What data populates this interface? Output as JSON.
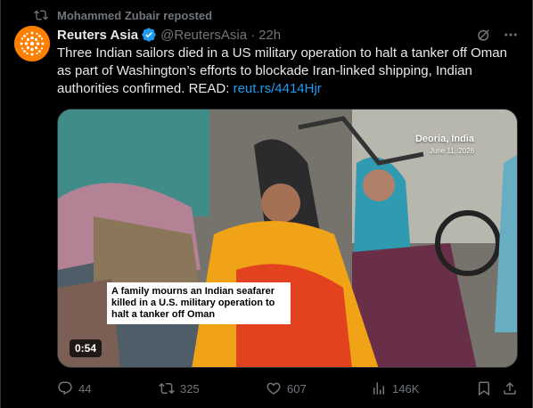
{
  "repost": {
    "icon": "repost-icon",
    "text": "Mohammed Zubair reposted"
  },
  "post": {
    "author_name": "Reuters Asia",
    "handle": "@ReutersAsia",
    "separator": "·",
    "time": "22h",
    "text": "Three Indian sailors died in a US military operation to halt a tanker off Oman as part of Washington’s efforts to blockade Iran-linked shipping, Indian authorities confirmed. READ: ",
    "link_text": "reut.rs/4414Hjr"
  },
  "media": {
    "location": "Deoria, India",
    "date": "June 11, 2026",
    "caption": "A family mourns an Indian seafarer killed in a U.S. military operation to halt a tanker off Oman",
    "duration": "0:54"
  },
  "actions": {
    "replies": "44",
    "reposts": "325",
    "likes": "607",
    "views": "146K"
  },
  "colors": {
    "link": "#1d9bf0",
    "muted": "#71767b",
    "verified": "#1d9bf0",
    "avatar": "#ff8000"
  }
}
